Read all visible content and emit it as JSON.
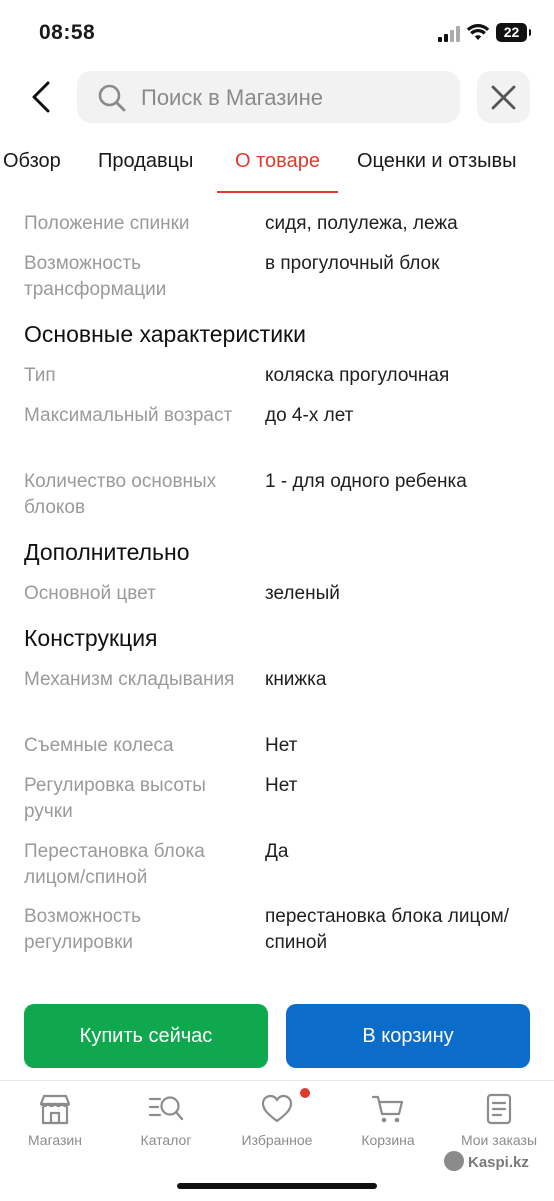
{
  "status": {
    "time": "08:58",
    "battery": "22"
  },
  "header": {
    "search_placeholder": "Поиск в Магазине"
  },
  "tabs": [
    {
      "label": "Обзор"
    },
    {
      "label": "Продавцы"
    },
    {
      "label": "О товаре"
    },
    {
      "label": "Оценки и отзывы"
    }
  ],
  "specs": {
    "top_rows": [
      {
        "label": "Положение спинки",
        "value": "сидя, полулежа, лежа"
      },
      {
        "label": "Возможность трансформации",
        "value": "в прогулочный блок"
      }
    ],
    "sections": [
      {
        "title": "Основные характеристики",
        "rows": [
          {
            "label": "Тип",
            "value": "коляска прогулочная"
          },
          {
            "label": "Максимальный возраст",
            "value": "до 4-х лет"
          },
          {
            "label": "Количество основных блоков",
            "value": "1 - для одного ребенка"
          }
        ]
      },
      {
        "title": "Дополнительно",
        "rows": [
          {
            "label": "Основной цвет",
            "value": "зеленый"
          }
        ]
      },
      {
        "title": "Конструкция",
        "rows": [
          {
            "label": "Механизм складывания",
            "value": "книжка"
          },
          {
            "label": "Съемные колеса",
            "value": "Нет"
          },
          {
            "label": "Регулировка высоты ручки",
            "value": "Нет"
          },
          {
            "label": "Перестановка блока лицом/спиной",
            "value": "Да"
          },
          {
            "label": "Возможность регулировки",
            "value": "перестановка блока лицом/спиной"
          }
        ]
      }
    ]
  },
  "actions": {
    "buy_now": "Купить сейчас",
    "add_to_cart": "В корзину"
  },
  "nav": [
    {
      "label": "Магазин",
      "icon": "store-icon"
    },
    {
      "label": "Каталог",
      "icon": "catalog-search-icon"
    },
    {
      "label": "Избранное",
      "icon": "heart-icon"
    },
    {
      "label": "Корзина",
      "icon": "cart-icon"
    },
    {
      "label": "Мои заказы",
      "icon": "orders-icon"
    }
  ],
  "brand": "Kaspi.kz",
  "colors": {
    "accent_red": "#e03a2f",
    "buy_green": "#10a84e",
    "cart_blue": "#0b6cc9"
  }
}
